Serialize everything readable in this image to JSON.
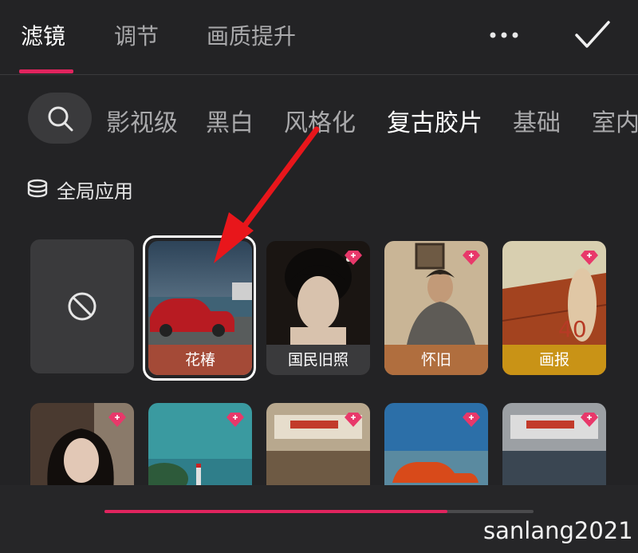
{
  "tabs": [
    {
      "label": "滤镜",
      "active": true
    },
    {
      "label": "调节",
      "active": false
    },
    {
      "label": "画质提升",
      "active": false
    }
  ],
  "icons": {
    "more": "more-dots-icon",
    "confirm": "check-icon",
    "search": "search-icon",
    "global": "layers-icon",
    "none": "no-filter-icon",
    "vip": "diamond-icon"
  },
  "categories": [
    {
      "label": "影视级",
      "active": false
    },
    {
      "label": "黑白",
      "active": false
    },
    {
      "label": "风格化",
      "active": false
    },
    {
      "label": "复古胶片",
      "active": true
    },
    {
      "label": "基础",
      "active": false
    },
    {
      "label": "室内",
      "active": false
    }
  ],
  "global_apply": {
    "label": "全局应用"
  },
  "filters_row1": [
    {
      "label": "花椿",
      "selected": true,
      "vip": false,
      "label_color": "#a44a37"
    },
    {
      "label": "国民旧照",
      "selected": false,
      "vip": true,
      "label_color": "#3a3a3c"
    },
    {
      "label": "怀旧",
      "selected": false,
      "vip": true,
      "label_color": "#b06e3e"
    },
    {
      "label": "画报",
      "selected": false,
      "vip": true,
      "label_color": "#c99316"
    }
  ],
  "scroll_progress": 0.8,
  "watermark": "sanlang2021",
  "colors": {
    "accent": "#e0245e",
    "background": "#232325",
    "vip_badge": "#e8386a"
  }
}
